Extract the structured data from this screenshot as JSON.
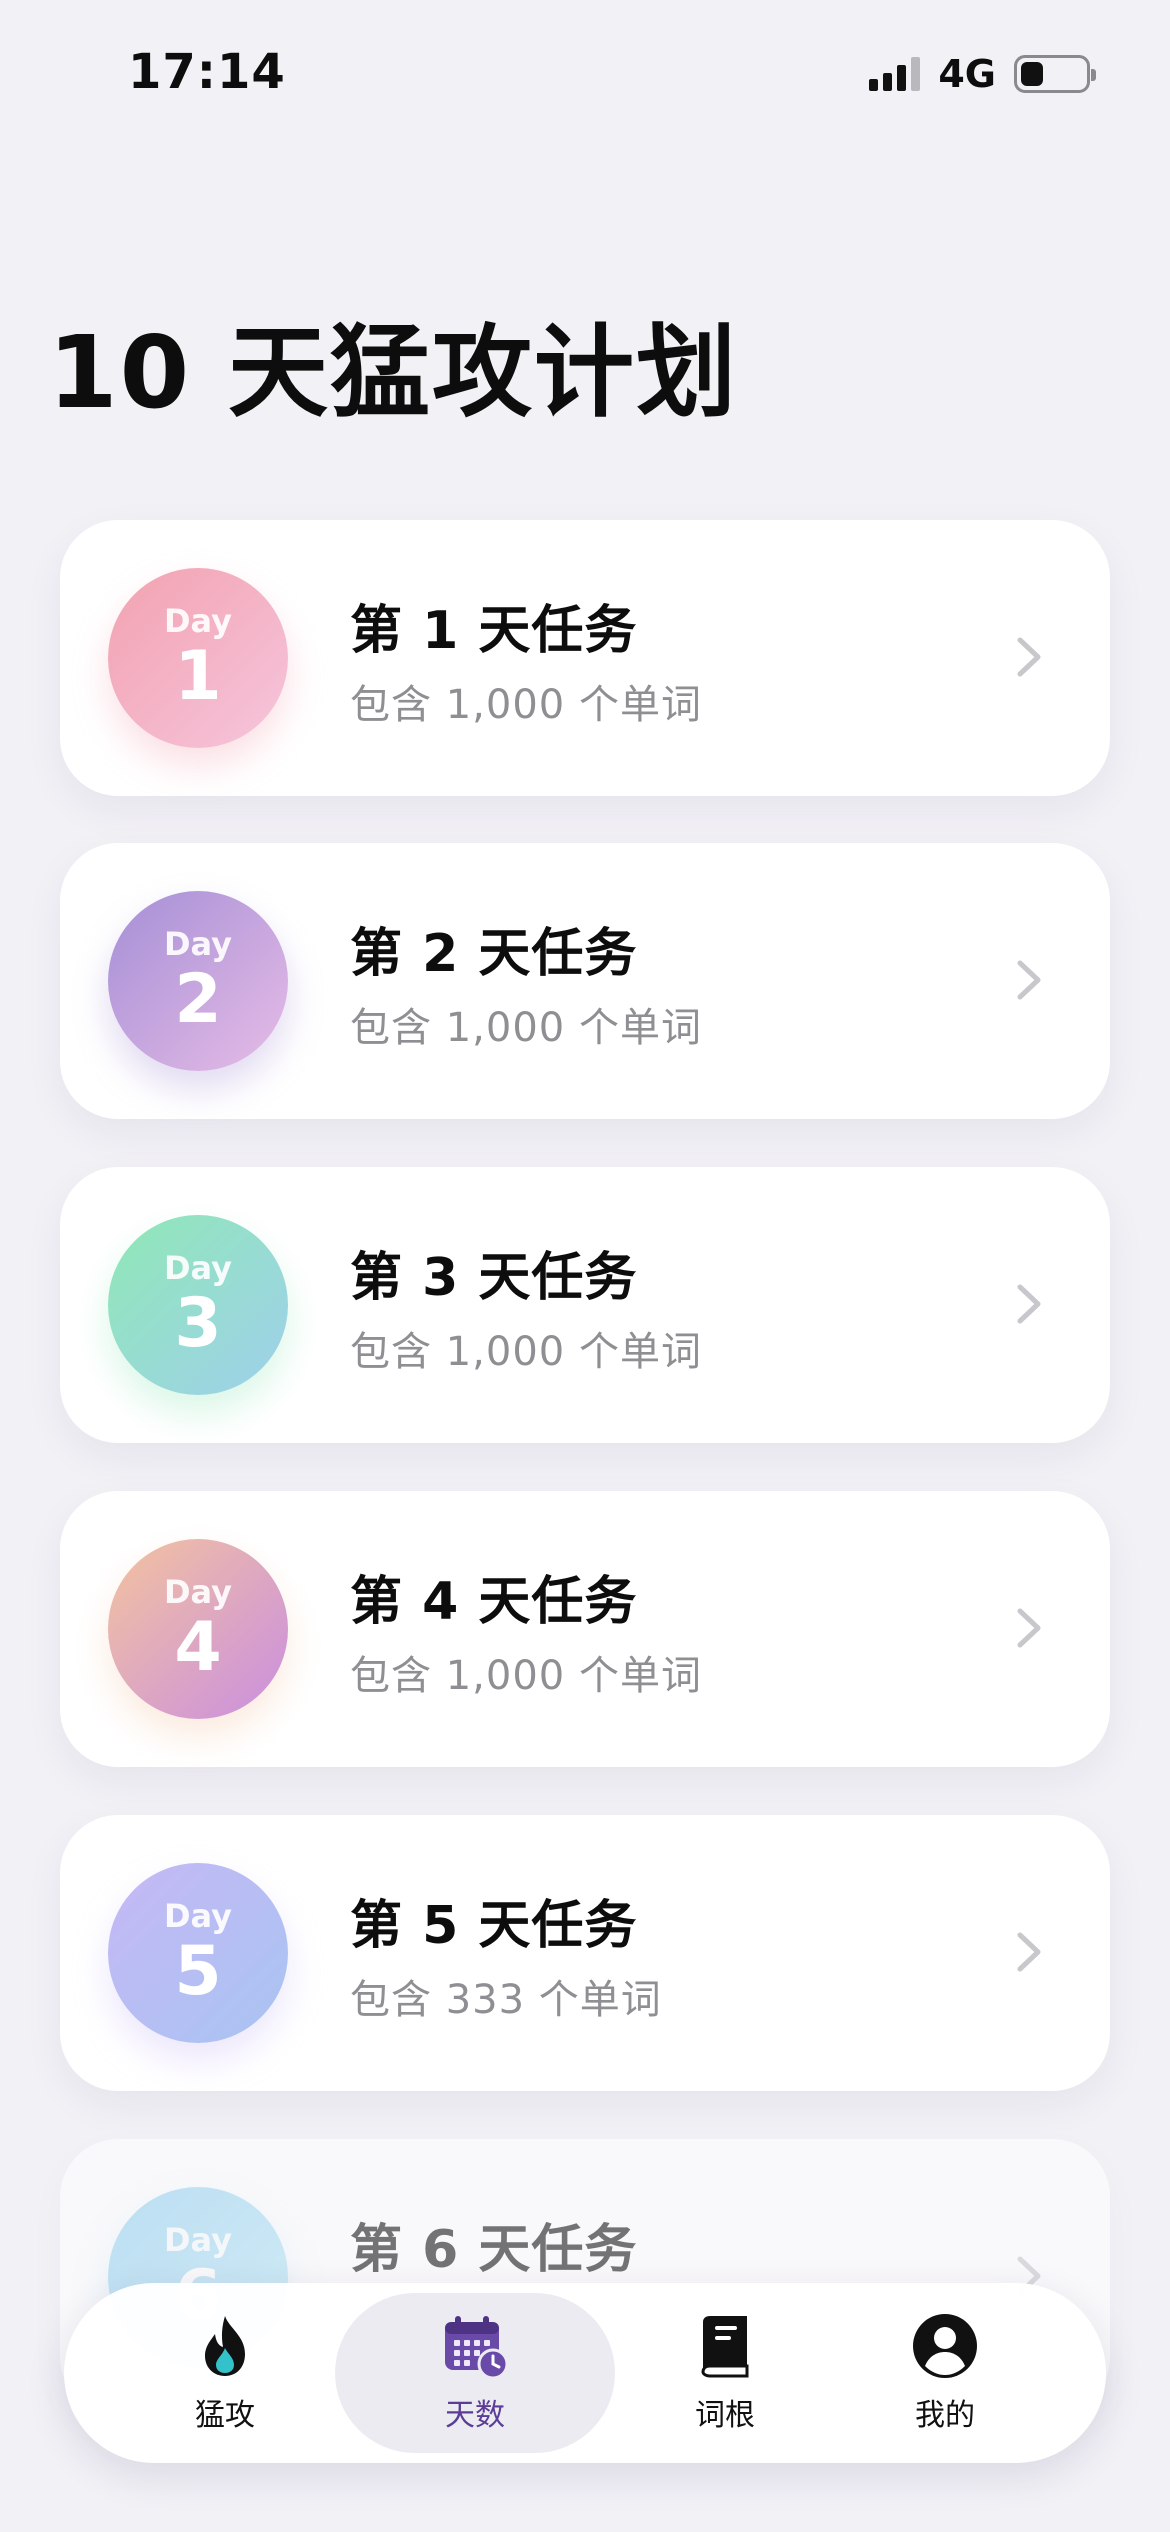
{
  "status_bar": {
    "time": "17:14",
    "network": "4G"
  },
  "page": {
    "title": "10 天猛攻计划"
  },
  "days": [
    {
      "badge_label": "Day",
      "number": "1",
      "title": "第 1 天任务",
      "subtitle": "包含 1,000 个单词",
      "gradient": [
        "#f2a2b0",
        "#f6c5dc"
      ]
    },
    {
      "badge_label": "Day",
      "number": "2",
      "title": "第 2 天任务",
      "subtitle": "包含 1,000 个单词",
      "gradient": [
        "#a58fd6",
        "#e6bce6"
      ]
    },
    {
      "badge_label": "Day",
      "number": "3",
      "title": "第 3 天任务",
      "subtitle": "包含 1,000 个单词",
      "gradient": [
        "#8fe8b6",
        "#9fd0ec"
      ]
    },
    {
      "badge_label": "Day",
      "number": "4",
      "title": "第 4 天任务",
      "subtitle": "包含 1,000 个单词",
      "gradient": [
        "#f4c39f",
        "#c98ee0"
      ]
    },
    {
      "badge_label": "Day",
      "number": "5",
      "title": "第 5 天任务",
      "subtitle": "包含 333 个单词",
      "gradient": [
        "#c6b8f5",
        "#a8c4f2"
      ]
    },
    {
      "badge_label": "Day",
      "number": "6",
      "title": "第 6 天任务",
      "subtitle": "",
      "gradient": [
        "#8fd0f0",
        "#b6e6f6"
      ]
    }
  ],
  "tabbar": {
    "tabs": [
      {
        "label": "猛攻",
        "icon": "flame-icon",
        "active": false
      },
      {
        "label": "天数",
        "icon": "calendar-clock-icon",
        "active": true
      },
      {
        "label": "词根",
        "icon": "book-icon",
        "active": false
      },
      {
        "label": "我的",
        "icon": "profile-icon",
        "active": false
      }
    ]
  },
  "colors": {
    "background": "#f2f1f6",
    "accent": "#5b3d96",
    "subtitle": "#8e8e93"
  }
}
